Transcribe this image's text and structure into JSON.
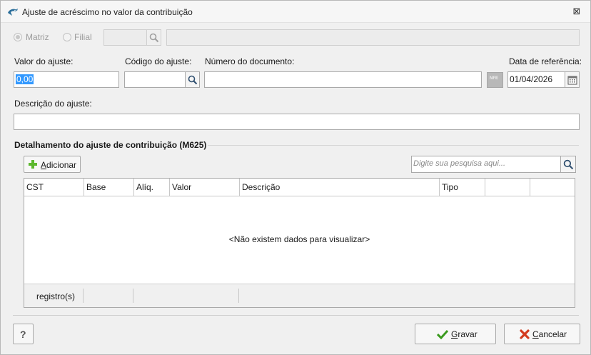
{
  "window": {
    "title": "Ajuste de acréscimo no valor da contribuição",
    "close_glyph": "⊠"
  },
  "branch": {
    "matriz_label": "Matriz",
    "filial_label": "Filial",
    "code_value": "",
    "name_value": ""
  },
  "form": {
    "valor_label": "Valor do ajuste:",
    "valor_value": "0,00",
    "codigo_label": "Código do ajuste:",
    "codigo_value": "",
    "numero_label": "Número do documento:",
    "numero_value": "",
    "nfe_badge": "NFE",
    "data_label": "Data de referência:",
    "data_value": "01/04/2026",
    "descricao_label": "Descrição do ajuste:",
    "descricao_value": ""
  },
  "section": {
    "title": "Detalhamento do ajuste de contribuição (M625)"
  },
  "toolbar": {
    "add_label_first": "A",
    "add_label_rest": "dicionar",
    "search_placeholder": "Digite sua pesquisa aqui..."
  },
  "grid": {
    "columns": [
      "CST",
      "Base",
      "Alíq.",
      "Valor",
      "Descrição",
      "Tipo",
      "",
      ""
    ],
    "empty_message": "<Não existem dados para visualizar>",
    "footer_label": "registro(s)"
  },
  "actions": {
    "help_label": "?",
    "save_first": "G",
    "save_rest": "ravar",
    "cancel_first": "C",
    "cancel_rest": "ancelar"
  },
  "icons": {
    "app": "dolphin-app-icon",
    "search": "magnifier-icon",
    "calendar": "calendar-icon",
    "add": "plus-icon",
    "save": "checkmark-icon",
    "cancel": "x-icon"
  },
  "colors": {
    "selection": "#3399ff",
    "add_green": "#5cb82e",
    "save_green": "#3a9a1e",
    "cancel_red": "#d33a1e"
  }
}
